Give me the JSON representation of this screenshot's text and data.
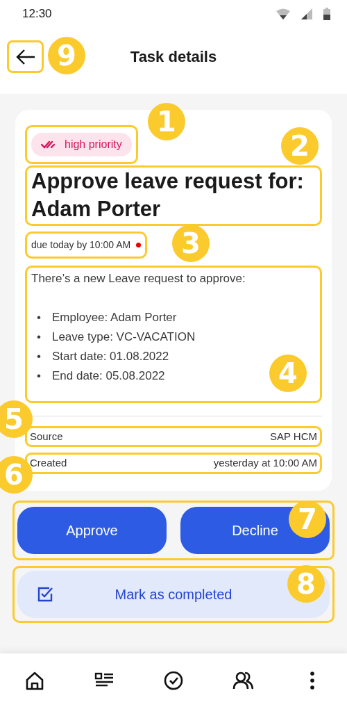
{
  "status_bar": {
    "time": "12:30"
  },
  "header": {
    "title": "Task details"
  },
  "task": {
    "priority": "high priority",
    "title": "Approve leave request for: Adam Porter",
    "due": "due today by 10:00 AM",
    "overdue": true,
    "description": {
      "intro": "There’s a new Leave request to approve:",
      "items": [
        {
          "bullet": "•",
          "text": "Employee: Adam Porter"
        },
        {
          "bullet": "•",
          "text": "Leave type: VC-VACATION"
        },
        {
          "bullet": "•",
          "text": "Start date: 01.08.2022"
        },
        {
          "bullet": "•",
          "text": "End date: 05.08.2022"
        }
      ]
    },
    "details": [
      {
        "label": "Source",
        "value": "SAP HCM"
      },
      {
        "label": "Created",
        "value": "yesterday at 10:00 AM"
      }
    ]
  },
  "actions": [
    "Approve",
    "Decline"
  ],
  "complete_button": "Mark as completed",
  "bottom_nav": [
    {
      "kind": "home"
    },
    {
      "kind": "list"
    },
    {
      "kind": "check"
    },
    {
      "kind": "people"
    },
    {
      "kind": "more"
    }
  ],
  "callouts": [
    "9",
    "1",
    "2",
    "3",
    "4",
    "5",
    "6",
    "7",
    "8"
  ]
}
